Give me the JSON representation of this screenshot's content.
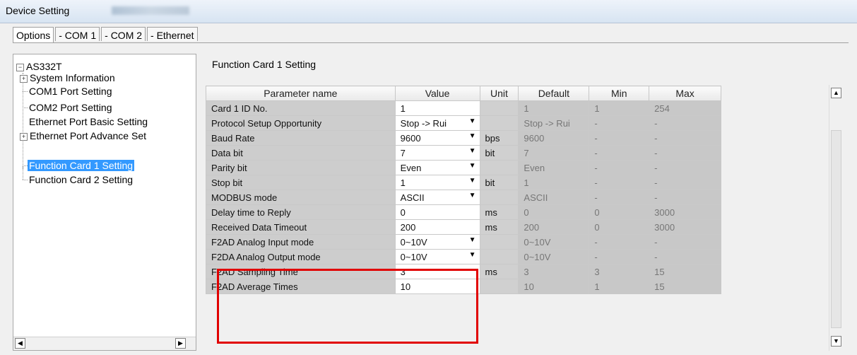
{
  "window": {
    "title": "Device Setting"
  },
  "tabs": [
    {
      "label": "Options"
    },
    {
      "label": "- COM 1"
    },
    {
      "label": "- COM 2"
    },
    {
      "label": "- Ethernet"
    }
  ],
  "tree": {
    "root": "AS332T",
    "items": [
      {
        "label": "System Information"
      },
      {
        "label": "COM1 Port Setting"
      },
      {
        "label": "COM2 Port Setting"
      },
      {
        "label": "Ethernet Port Basic Setting"
      },
      {
        "label": "Ethernet Port Advance Set"
      },
      {
        "label": "Function Card 1 Setting"
      },
      {
        "label": "Function Card 2 Setting"
      }
    ]
  },
  "section_title": "Function Card 1 Setting",
  "table": {
    "headers": [
      "Parameter name",
      "Value",
      "Unit",
      "Default",
      "Min",
      "Max"
    ],
    "rows": [
      {
        "name": "Card 1 ID No.",
        "value": "1",
        "dropdown": false,
        "unit": "",
        "default": "1",
        "min": "1",
        "max": "254"
      },
      {
        "name": "Protocol Setup Opportunity",
        "value": "Stop -> Rui",
        "dropdown": true,
        "unit": "",
        "default": "Stop -> Rui",
        "min": "-",
        "max": "-"
      },
      {
        "name": "Baud Rate",
        "value": "9600",
        "dropdown": true,
        "unit": "bps",
        "default": "9600",
        "min": "-",
        "max": "-"
      },
      {
        "name": "Data bit",
        "value": "7",
        "dropdown": true,
        "unit": "bit",
        "default": "7",
        "min": "-",
        "max": "-"
      },
      {
        "name": "Parity bit",
        "value": "Even",
        "dropdown": true,
        "unit": "",
        "default": "Even",
        "min": "-",
        "max": "-"
      },
      {
        "name": "Stop bit",
        "value": "1",
        "dropdown": true,
        "unit": "bit",
        "default": "1",
        "min": "-",
        "max": "-"
      },
      {
        "name": "MODBUS mode",
        "value": "ASCII",
        "dropdown": true,
        "unit": "",
        "default": "ASCII",
        "min": "-",
        "max": "-"
      },
      {
        "name": "Delay time to Reply",
        "value": "0",
        "dropdown": false,
        "unit": "ms",
        "default": "0",
        "min": "0",
        "max": "3000"
      },
      {
        "name": "Received Data Timeout",
        "value": "200",
        "dropdown": false,
        "unit": "ms",
        "default": "200",
        "min": "0",
        "max": "3000"
      },
      {
        "name": "F2AD Analog Input mode",
        "value": "0~10V",
        "dropdown": true,
        "unit": "",
        "default": "0~10V",
        "min": "-",
        "max": "-"
      },
      {
        "name": "F2DA Analog Output mode",
        "value": "0~10V",
        "dropdown": true,
        "unit": "",
        "default": "0~10V",
        "min": "-",
        "max": "-"
      },
      {
        "name": "F2AD Sampling Time",
        "value": "3",
        "dropdown": false,
        "unit": "ms",
        "default": "3",
        "min": "3",
        "max": "15"
      },
      {
        "name": "F2AD Average Times",
        "value": "10",
        "dropdown": false,
        "unit": "",
        "default": "10",
        "min": "1",
        "max": "15"
      }
    ]
  },
  "colors": {
    "selection": "#3399ff",
    "highlight_box": "#e10000"
  }
}
